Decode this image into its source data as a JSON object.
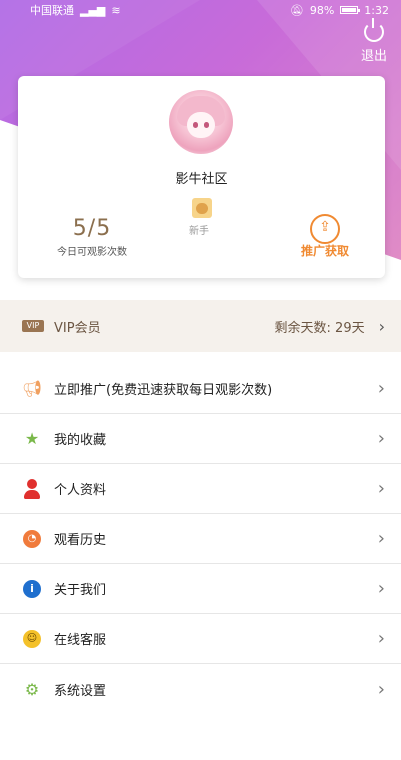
{
  "status_bar": {
    "carrier": "中国联通",
    "battery": "98%",
    "battery_level": 0.98,
    "time": "1:32"
  },
  "header": {
    "logout_label": "退出"
  },
  "profile": {
    "name": "影牛社区",
    "views_count": "5/5",
    "views_caption": "今日可观影次数",
    "rank_label": "新手",
    "promo_label": "推广获取"
  },
  "vip": {
    "badge": "VIP",
    "label": "VIP会员",
    "remaining": "剩余天数: 29天"
  },
  "menu": [
    {
      "label": "立即推广(免费迅速获取每日观影次数)",
      "icon": "megaphone-icon"
    },
    {
      "label": "我的收藏",
      "icon": "star-icon"
    },
    {
      "label": "个人资料",
      "icon": "user-icon"
    },
    {
      "label": "观看历史",
      "icon": "clock-icon"
    },
    {
      "label": "关于我们",
      "icon": "info-icon"
    },
    {
      "label": "在线客服",
      "icon": "customer-service-icon"
    },
    {
      "label": "系统设置",
      "icon": "gear-icon"
    }
  ],
  "colors": {
    "accent": "#f08a32",
    "vip_text": "#6b5542",
    "hero_start": "#b06be6",
    "hero_end": "#e08cc6"
  }
}
